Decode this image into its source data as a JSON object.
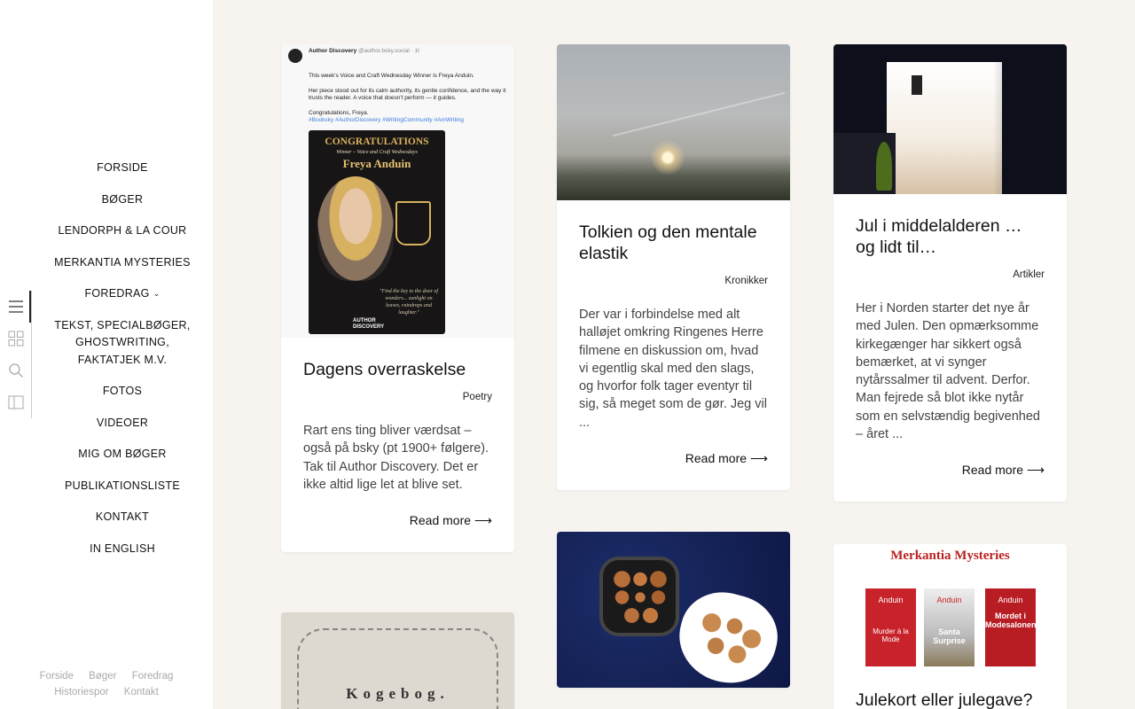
{
  "nav": {
    "items": [
      {
        "label": "FORSIDE"
      },
      {
        "label": "BØGER"
      },
      {
        "label": "LENDORPH & LA COUR"
      },
      {
        "label": "MERKANTIA MYSTERIES"
      },
      {
        "label": "FOREDRAG",
        "has_submenu": true
      },
      {
        "label": "TEKST, SPECIALBØGER, GHOSTWRITING, FAKTATJEK M.V."
      },
      {
        "label": "FOTOS"
      },
      {
        "label": "VIDEOER"
      },
      {
        "label": "MIG OM BØGER"
      },
      {
        "label": "PUBLIKATIONSLISTE"
      },
      {
        "label": "KONTAKT"
      },
      {
        "label": "IN ENGLISH"
      }
    ]
  },
  "iconbar": {
    "icons": [
      "menu-icon",
      "grid-icon",
      "search-icon",
      "sidebar-toggle-icon"
    ]
  },
  "footer": {
    "links": [
      "Forside",
      "Bøger",
      "Foredrag",
      "Historiespor",
      "Kontakt"
    ]
  },
  "posts": [
    {
      "title": "Dagens overraskelse",
      "category": "Poetry",
      "excerpt": "Rart ens ting bliver værdsat – også på bsky (pt 1900+ følgere). Tak til Author Discovery. Det er ikke altid lige let at blive set.",
      "more": "Read more ⟶",
      "image": {
        "type": "tweet",
        "author": "Author Discovery",
        "handle": "@author.bsky.social · 1t",
        "line1": "This week's Voice and Craft Wednesday Winner is Freya Anduin.",
        "line2": "Her piece stood out for its calm authority, its gentle confidence, and the way it trusts the reader. A voice that doesn't perform — it guides.",
        "line3": "Congratulations, Freya.",
        "tags": "#Booksky #AuthorDiscovery #WritingCommunity #AmWriting",
        "poster_title": "CONGRATULATIONS",
        "poster_sub": "Winner – Voice and Craft Wednesdays",
        "poster_name": "Freya Anduin",
        "poster_quote": "\"Find the key to the door of wonders... sunlight on leaves, raindrops and laughter.\"",
        "poster_logo": "AUTHOR DISCOVERY"
      }
    },
    {
      "title": "Tolkien og den mentale elastik",
      "category": "Kronikker",
      "excerpt": "Der var i forbindelse med alt halløjet omkring Ringenes Herre filmene en diskussion om, hvad vi egentlig skal med den slags, og hvorfor folk tager eventyr til sig, så meget som de gør. Jeg vil ...",
      "more": "Read more ⟶",
      "image": {
        "type": "sunset"
      }
    },
    {
      "title": "Jul i middelalderen … og lidt til…",
      "category": "Artikler",
      "excerpt": "Her i Norden starter det nye år med Julen. Den opmærksomme kirkegænger har sikkert også bemærket, at vi synger nytårssalmer til advent. Derfor. Man fejrede så blot ikke nytår som en selvstændig begivenhed – året ...",
      "more": "Read more ⟶",
      "image": {
        "type": "church"
      }
    },
    {
      "title": "",
      "image": {
        "type": "cookbook",
        "text": "Kogebog."
      }
    },
    {
      "title": "",
      "image": {
        "type": "aebleskiver"
      }
    },
    {
      "title": "Julekort eller julegave?",
      "image": {
        "type": "books",
        "header": "Merkantia Mysteries",
        "book1": "Murder à la Mode",
        "book2": "Santa Surprise",
        "book3": "Mordet i Modesalonen",
        "author": "Anduin"
      }
    }
  ]
}
